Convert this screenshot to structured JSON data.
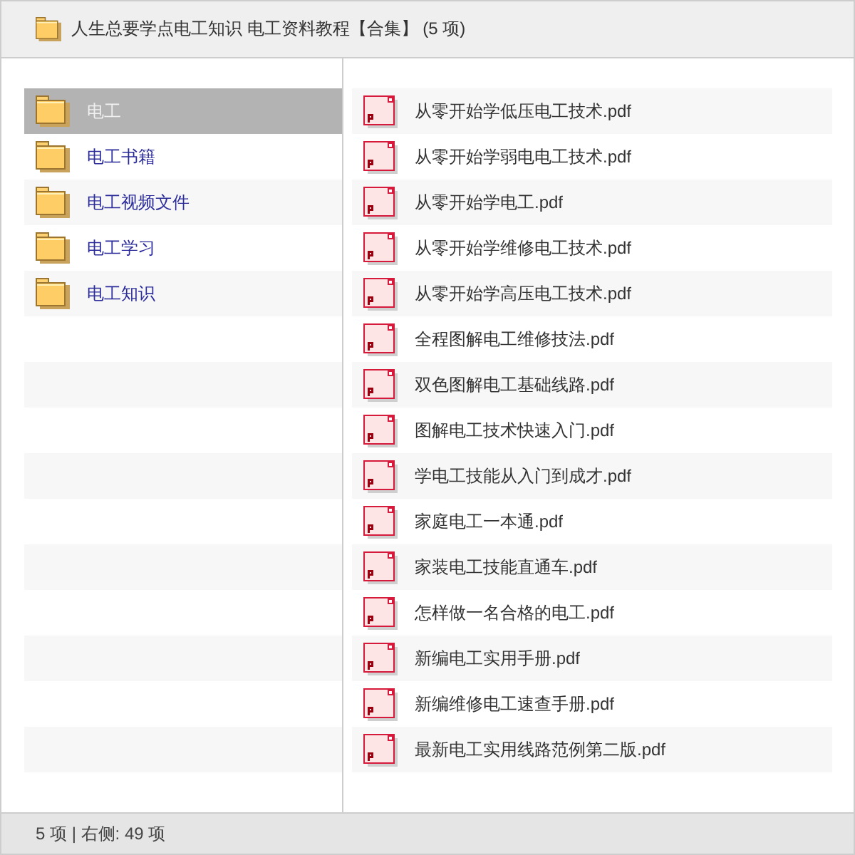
{
  "header": {
    "title": "人生总要学点电工知识 电工资料教程【合集】 (5 项)"
  },
  "folders": [
    {
      "name": "电工",
      "selected": true
    },
    {
      "name": "电工书籍",
      "selected": false
    },
    {
      "name": "电工视频文件",
      "selected": false
    },
    {
      "name": "电工学习",
      "selected": false
    },
    {
      "name": "电工知识",
      "selected": false
    }
  ],
  "files": [
    {
      "name": "从零开始学低压电工技术.pdf"
    },
    {
      "name": "从零开始学弱电电工技术.pdf"
    },
    {
      "name": "从零开始学电工.pdf"
    },
    {
      "name": "从零开始学维修电工技术.pdf"
    },
    {
      "name": "从零开始学高压电工技术.pdf"
    },
    {
      "name": "全程图解电工维修技法.pdf"
    },
    {
      "name": "双色图解电工基础线路.pdf"
    },
    {
      "name": "图解电工技术快速入门.pdf"
    },
    {
      "name": "学电工技能从入门到成才.pdf"
    },
    {
      "name": "家庭电工一本通.pdf"
    },
    {
      "name": "家装电工技能直通车.pdf"
    },
    {
      "name": "怎样做一名合格的电工.pdf"
    },
    {
      "name": "新编电工实用手册.pdf"
    },
    {
      "name": "新编维修电工速查手册.pdf"
    },
    {
      "name": "最新电工实用线路范例第二版.pdf"
    }
  ],
  "status_bar": {
    "text": "5 项 | 右侧: 49 项"
  }
}
